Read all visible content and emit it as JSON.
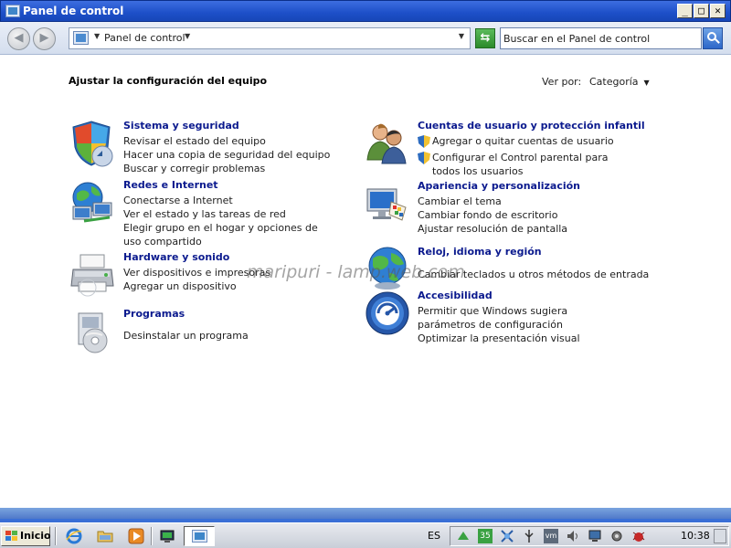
{
  "window": {
    "title": "Panel de control",
    "controls": {
      "minimize": "_",
      "maximize": "□",
      "close": "✕"
    }
  },
  "nav": {
    "back_icon": "back-arrow-icon",
    "forward_icon": "forward-arrow-icon",
    "address_text": "Panel de control",
    "search_placeholder": "Buscar en el Panel de control"
  },
  "main": {
    "title": "Ajustar la configuración del equipo",
    "view_by_label": "Ver por:",
    "view_by_value": "Categoría",
    "watermark": "maripuri - lamp.web.com"
  },
  "categories": [
    {
      "title": "Sistema y seguridad",
      "icon": "shield-icon",
      "links": [
        "Revisar el estado del equipo",
        "Hacer una copia de seguridad del equipo",
        "Buscar y corregir problemas"
      ]
    },
    {
      "title": "Redes e Internet",
      "icon": "network-globe-icon",
      "links": [
        "Conectarse a Internet",
        "Ver el estado y las tareas de red",
        "Elegir grupo en el hogar y opciones de uso compartido"
      ]
    },
    {
      "title": "Hardware y sonido",
      "icon": "printer-icon",
      "links": [
        "Ver dispositivos e impresoras",
        "Agregar un dispositivo"
      ]
    },
    {
      "title": "Programas",
      "icon": "programs-disc-icon",
      "links": [
        "Desinstalar un programa"
      ]
    },
    {
      "title": "Cuentas de usuario y protección infantil",
      "icon": "users-icon",
      "links": [
        "Agregar o quitar cuentas de usuario",
        "Configurar el Control parental para todos los usuarios"
      ]
    },
    {
      "title": "Apariencia y personalización",
      "icon": "display-palette-icon",
      "links": [
        "Cambiar el tema",
        "Cambiar fondo de escritorio",
        "Ajustar resolución de pantalla"
      ]
    },
    {
      "title": "Reloj, idioma y región",
      "icon": "globe-clock-icon",
      "links": [
        "Cambiar teclados u otros métodos de entrada"
      ]
    },
    {
      "title": "Accesibilidad",
      "icon": "accessibility-icon",
      "links": [
        "Permitir que Windows sugiera parámetros de configuración",
        "Optimizar la presentación visual"
      ]
    }
  ],
  "taskbar": {
    "start_label": "Inicio",
    "language": "ES",
    "tray_badge": "35",
    "tray_vm": "vm",
    "clock": "10:38"
  },
  "colors": {
    "link_title": "#0b1a8e",
    "title_bar": "#1d4fc8",
    "desktop": "#3a6fd6"
  }
}
